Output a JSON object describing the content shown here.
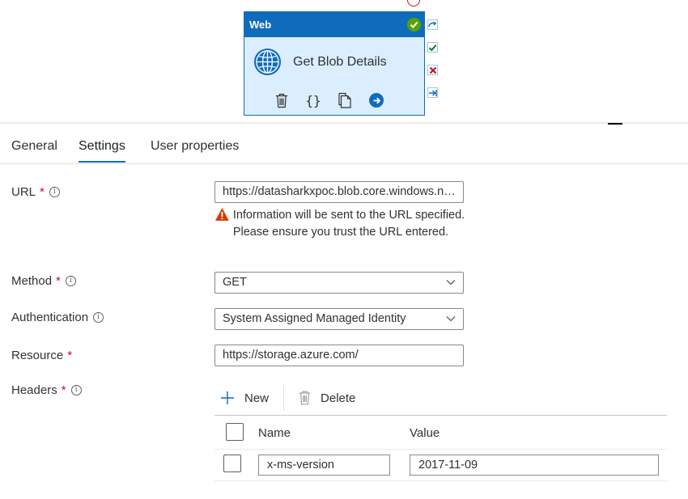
{
  "activity": {
    "type_label": "Web",
    "name": "Get Blob Details",
    "status_icon": "success-check-icon",
    "actions": [
      "delete-icon",
      "code-braces-icon",
      "copy-icon",
      "go-arrow-icon"
    ],
    "connectors": [
      "skip-icon",
      "success-icon",
      "failure-icon",
      "completion-icon"
    ],
    "braces_glyph": "{}"
  },
  "tabs": [
    {
      "label": "General"
    },
    {
      "label": "Settings"
    },
    {
      "label": "User properties"
    }
  ],
  "active_tab": "Settings",
  "form": {
    "url": {
      "label": "URL",
      "required": "*",
      "value": "https://datasharkxpoc.blob.core.windows.net/",
      "warning": "Information will be sent to the URL specified. Please ensure you trust the URL entered."
    },
    "method": {
      "label": "Method",
      "required": "*",
      "value": "GET"
    },
    "authentication": {
      "label": "Authentication",
      "value": "System Assigned Managed Identity"
    },
    "resource": {
      "label": "Resource",
      "required": "*",
      "value": "https://storage.azure.com/"
    },
    "headers": {
      "label": "Headers",
      "required": "*",
      "new_label": "New",
      "delete_label": "Delete",
      "columns": [
        "Name",
        "Value"
      ],
      "rows": [
        {
          "name": "x-ms-version",
          "value": "2017-11-09"
        }
      ]
    },
    "info_glyph": "i"
  },
  "colors": {
    "accent": "#0f6cbd",
    "required": "#c50f1f",
    "warning": "#d83b01",
    "success": "#57a300"
  }
}
